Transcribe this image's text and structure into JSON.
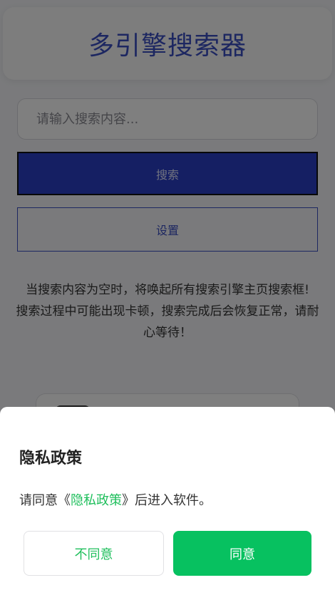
{
  "header": {
    "title": "多引擎搜索器"
  },
  "search": {
    "placeholder": "请输入搜索内容...",
    "value": ""
  },
  "buttons": {
    "search_label": "搜索",
    "settings_label": "设置"
  },
  "notice": {
    "line1": "当搜索内容为空时，将唤起所有搜索引擎主页搜索框!",
    "line2": "搜索过程中可能出现卡顿，搜索完成后会恢复正常，请耐心等待！"
  },
  "privacy_dialog": {
    "title": "隐私政策",
    "body_prefix": "请同意《",
    "link_text": "隐私政策",
    "body_suffix": "》后进入软件。",
    "disagree_label": "不同意",
    "agree_label": "同意"
  },
  "colors": {
    "accent": "#3b4fc2",
    "primary_button": "#2b3fc6",
    "agree_green": "#07c160",
    "link_green": "#1fbf5c"
  }
}
